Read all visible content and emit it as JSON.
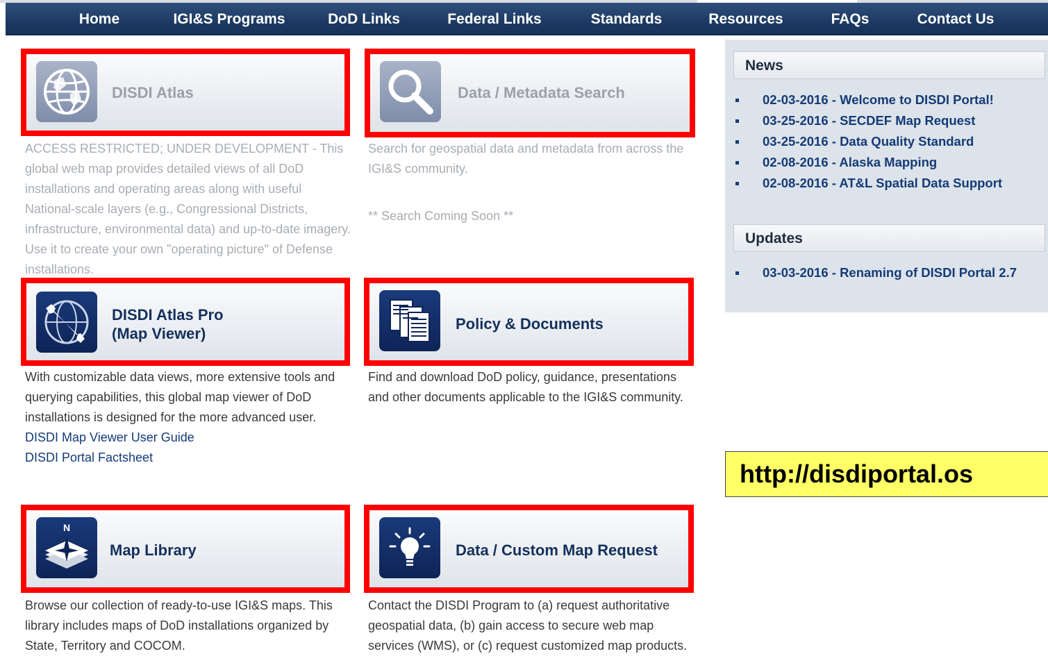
{
  "nav": {
    "home": "Home",
    "programs": "IGI&S Programs",
    "dod_links": "DoD Links",
    "federal_links": "Federal Links",
    "standards": "Standards",
    "resources": "Resources",
    "faqs": "FAQs",
    "contact": "Contact Us"
  },
  "tiles": {
    "atlas": {
      "title": "DISDI Atlas",
      "desc": "ACCESS RESTRICTED; UNDER DEVELOPMENT - This global web map provides detailed views of all DoD installations and operating areas along with useful National-scale layers (e.g., Congressional Districts, infrastructure, environmental data) and up-to-date imagery. Use it to create your own \"operating picture\" of Defense installations."
    },
    "search": {
      "title": "Data / Metadata Search",
      "desc": "Search for geospatial data and metadata from across the IGI&S community.",
      "note": "** Search Coming Soon **"
    },
    "atlas_pro": {
      "title_line1": "DISDI Atlas Pro",
      "title_line2": "(Map Viewer)",
      "desc": "With customizable data views, more extensive tools and querying capabilities, this global map viewer of DoD installations is designed for the more advanced user.",
      "link1": "DISDI Map Viewer User Guide",
      "link2": "DISDI Portal Factsheet"
    },
    "policy": {
      "title": "Policy & Documents",
      "desc": "Find and download DoD policy, guidance, presentations and other documents applicable to the IGI&S community."
    },
    "map_library": {
      "title": "Map Library",
      "icon_letter": "N",
      "desc": "Browse our collection of ready-to-use IGI&S maps. This library includes maps of DoD installations organized by State, Territory and COCOM."
    },
    "custom_map": {
      "title": "Data / Custom Map Request",
      "desc": "Contact the DISDI Program to (a) request authoritative geospatial data, (b) gain access to secure web map services (WMS), or (c) request customized map products."
    }
  },
  "sidebar": {
    "news_title": "News",
    "news": [
      "02-03-2016 - Welcome to DISDI Portal!",
      "03-25-2016 - SECDEF Map Request",
      "03-25-2016 - Data Quality Standard",
      "02-08-2016 - Alaska Mapping",
      "02-08-2016 - AT&L Spatial Data Support"
    ],
    "updates_title": "Updates",
    "updates": [
      "03-03-2016 - Renaming of DISDI Portal 2.7"
    ]
  },
  "callout": {
    "url_text": "http://disdiportal.os"
  },
  "colors": {
    "nav_bg": "#1d3a63",
    "tile_border": "#ff0000",
    "link": "#143b78",
    "callout_bg": "#ffff66"
  }
}
